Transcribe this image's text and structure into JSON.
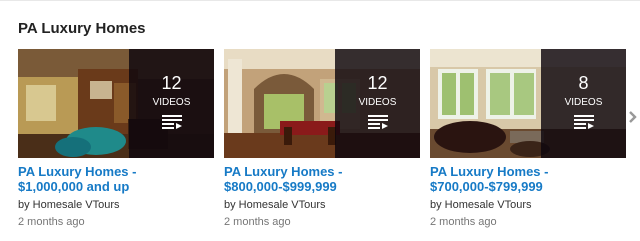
{
  "shelf": {
    "title": "PA Luxury Homes"
  },
  "cards": [
    {
      "count": "12",
      "count_label": "VIDEOS",
      "title_line1": "PA Luxury Homes -",
      "title_line2": "$1,000,000 and up",
      "byline": "by Homesale VTours",
      "age": "2 months ago"
    },
    {
      "count": "12",
      "count_label": "VIDEOS",
      "title_line1": "PA Luxury Homes -",
      "title_line2": "$800,000-$999,999",
      "byline": "by Homesale VTours",
      "age": "2 months ago"
    },
    {
      "count": "8",
      "count_label": "VIDEOS",
      "title_line1": "PA Luxury Homes -",
      "title_line2": "$700,000-$799,999",
      "byline": "by Homesale VTours",
      "age": "2 months ago"
    }
  ],
  "icons": {
    "playlist": "playlist-icon",
    "next": "chevron-right-icon"
  },
  "colors": {
    "link": "#167ac6",
    "overlay": "#0e060e",
    "meta": "#767676"
  }
}
